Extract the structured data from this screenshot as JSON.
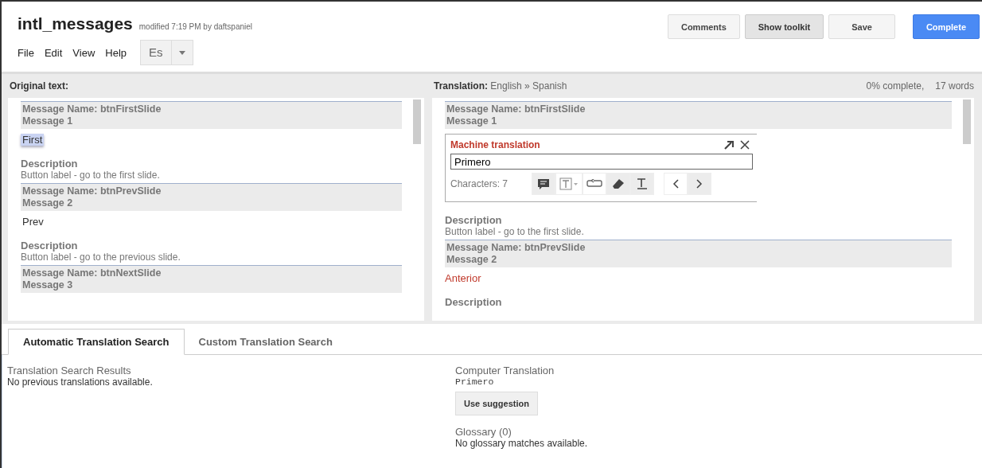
{
  "document": {
    "title": "intl_messages",
    "modified": "modified 7:19 PM by daftspaniel"
  },
  "menu": [
    "File",
    "Edit",
    "View",
    "Help"
  ],
  "language_button": {
    "label": "Es"
  },
  "buttons": [
    {
      "label": "Comments",
      "kind": "default"
    },
    {
      "label": "Show toolkit",
      "kind": "pressed"
    },
    {
      "label": "Save",
      "kind": "default"
    },
    {
      "label": "Complete",
      "kind": "primary"
    }
  ],
  "original_pane": {
    "heading": "Original text:",
    "entries": [
      {
        "name": "Message Name: btnFirstSlide",
        "message": "Message 1",
        "text": "First",
        "selected": true,
        "description_label": "Description",
        "description": "Button label - go to the first slide."
      },
      {
        "name": "Message Name: btnPrevSlide",
        "message": "Message 2",
        "text": "Prev",
        "selected": false,
        "description_label": "Description",
        "description": "Button label - go to the previous slide."
      },
      {
        "name": "Message Name: btnNextSlide",
        "message": "Message 3"
      }
    ]
  },
  "translation_pane": {
    "heading_label": "Translation:",
    "heading_value": "English » Spanish",
    "progress": "0% complete,",
    "word_count": "17 words",
    "entries": [
      {
        "name": "Message Name: btnFirstSlide",
        "message": "Message 1",
        "machine_translation": {
          "title": "Machine translation",
          "value": "Primero",
          "characters": "Characters: 7"
        },
        "description_label": "Description",
        "description": "Button label - go to the first slide."
      },
      {
        "name": "Message Name: btnPrevSlide",
        "message": "Message 2",
        "text": "Anterior",
        "description_label": "Description"
      }
    ]
  },
  "tabs": [
    {
      "label": "Automatic Translation Search",
      "selected": true
    },
    {
      "label": "Custom Translation Search",
      "selected": false
    }
  ],
  "search_results": {
    "heading": "Translation Search Results",
    "text": "No previous translations available."
  },
  "computer_translation": {
    "heading": "Computer Translation",
    "value": "Primero",
    "button": "Use suggestion"
  },
  "glossary": {
    "heading": "Glossary (0)",
    "text": "No glossary matches available."
  }
}
